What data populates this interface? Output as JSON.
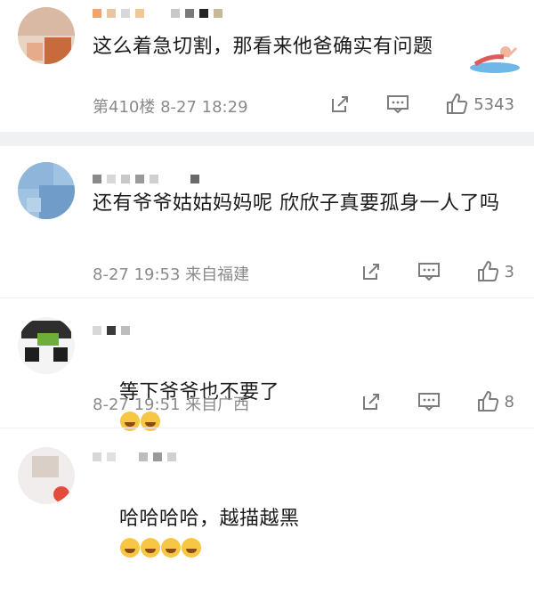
{
  "comments": [
    {
      "text": "这么着急切割，那看来他爸确实有问题",
      "meta": "第410楼 8-27 18:29",
      "likes": "5343",
      "icons": [
        "share-icon",
        "comment-icon",
        "like-icon"
      ]
    },
    {
      "text": "还有爷爷姑姑妈妈呢 欣欣子真要孤身一人了吗",
      "meta": "8-27 19:53 来自福建",
      "likes": "3",
      "icons": [
        "share-icon",
        "comment-icon",
        "like-icon"
      ]
    },
    {
      "text": "等下爷爷也不要了",
      "meta": "8-27 19:51 来自广西",
      "likes": "8",
      "icons": [
        "share-icon",
        "comment-icon",
        "like-icon"
      ]
    },
    {
      "text": "哈哈哈哈，越描越黑",
      "icons": []
    }
  ],
  "colors": {
    "divider": "#f0f1f3",
    "meta_text": "#8a8a8a",
    "body_text": "#1b1b1b"
  }
}
